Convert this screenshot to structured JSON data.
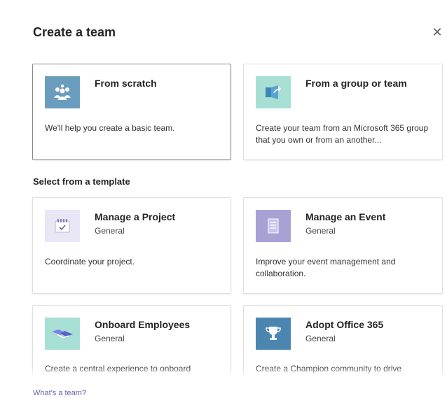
{
  "dialog": {
    "title": "Create a team",
    "close_glyph": "✕"
  },
  "top_cards": [
    {
      "name": "From scratch",
      "description": "We'll help you create a basic team.",
      "icon": "people-icon",
      "color": "#6a9cbd"
    },
    {
      "name": "From a group or team",
      "description": "Create your team from an Microsoft 365 group that you own or from an another...",
      "icon": "group-share-icon",
      "color": "#a8dfd4"
    }
  ],
  "template_section": {
    "heading": "Select from a template"
  },
  "templates": [
    {
      "name": "Manage a Project",
      "category": "General",
      "description": "Coordinate your project.",
      "icon": "calendar-check-icon",
      "color": "#e9e6f6"
    },
    {
      "name": "Manage an Event",
      "category": "General",
      "description": "Improve your event management and collaboration.",
      "icon": "event-list-icon",
      "color": "#a8a2d4"
    },
    {
      "name": "Onboard Employees",
      "category": "General",
      "description": "Create a central experience to onboard",
      "icon": "handshake-icon",
      "color": "#a8dfd4"
    },
    {
      "name": "Adopt Office 365",
      "category": "General",
      "description": "Create a Champion community to drive",
      "icon": "trophy-icon",
      "color": "#4a86b0"
    }
  ],
  "footer": {
    "link": "What's a team?"
  }
}
